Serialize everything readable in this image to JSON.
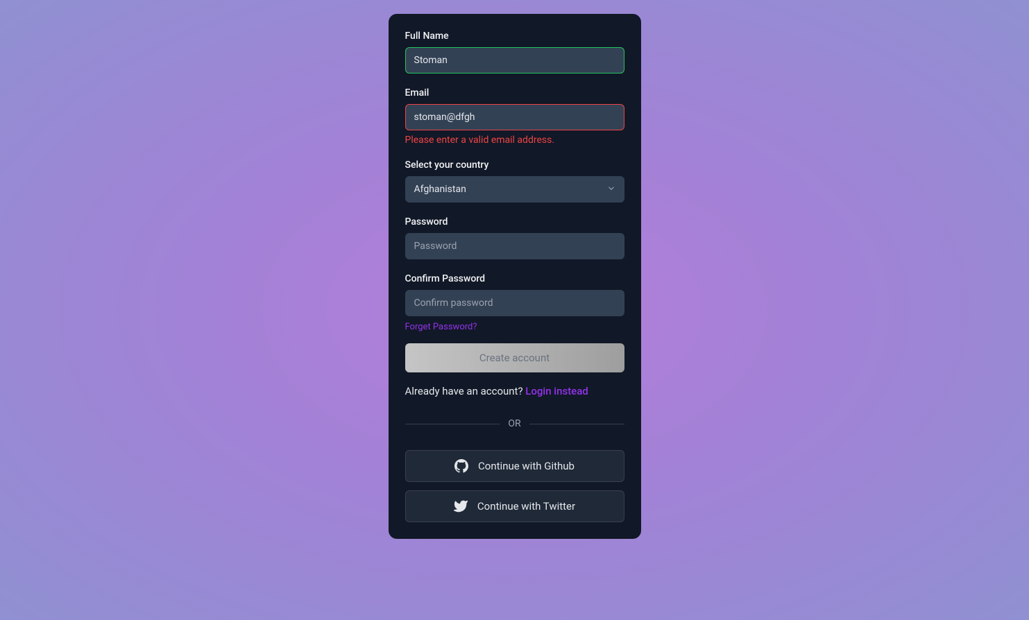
{
  "form": {
    "fullName": {
      "label": "Full Name",
      "value": "Stoman"
    },
    "email": {
      "label": "Email",
      "value": "stoman@dfgh",
      "error": "Please enter a valid email address."
    },
    "country": {
      "label": "Select your country",
      "value": "Afghanistan"
    },
    "password": {
      "label": "Password",
      "placeholder": "Password"
    },
    "confirmPassword": {
      "label": "Confirm Password",
      "placeholder": "Confirm password"
    },
    "forgotPassword": "Forget Password?",
    "submit": "Create account",
    "loginPrompt": "Already have an account? ",
    "loginLink": "Login instead"
  },
  "divider": "OR",
  "social": {
    "github": "Continue with Github",
    "twitter": "Continue with Twitter"
  }
}
